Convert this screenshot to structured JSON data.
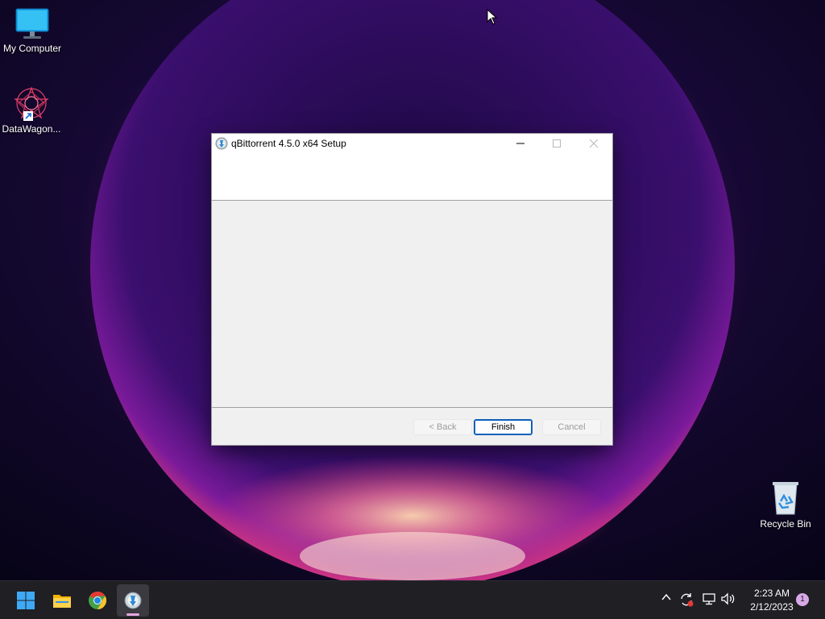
{
  "desktop": {
    "icons": [
      {
        "label": "My Computer",
        "icon": "monitor-icon"
      },
      {
        "label": "DataWagon...",
        "icon": "datawagon-app-icon",
        "shortcut": true
      },
      {
        "label": "Recycle Bin",
        "icon": "recycle-bin-icon"
      }
    ]
  },
  "window": {
    "title": "qBittorrent 4.5.0 x64 Setup",
    "buttons": {
      "back": "< Back",
      "finish": "Finish",
      "cancel": "Cancel"
    }
  },
  "taskbar": {
    "apps": [
      "start-icon",
      "file-explorer-icon",
      "chrome-icon",
      "qbittorrent-icon"
    ],
    "clock": {
      "time": "2:23 AM",
      "date": "2/12/2023"
    },
    "notification_count": "1"
  },
  "colors": {
    "accent": "#0b5fb8",
    "taskbar": "#1f1f24",
    "dialog_bg": "#f0f0f0"
  }
}
